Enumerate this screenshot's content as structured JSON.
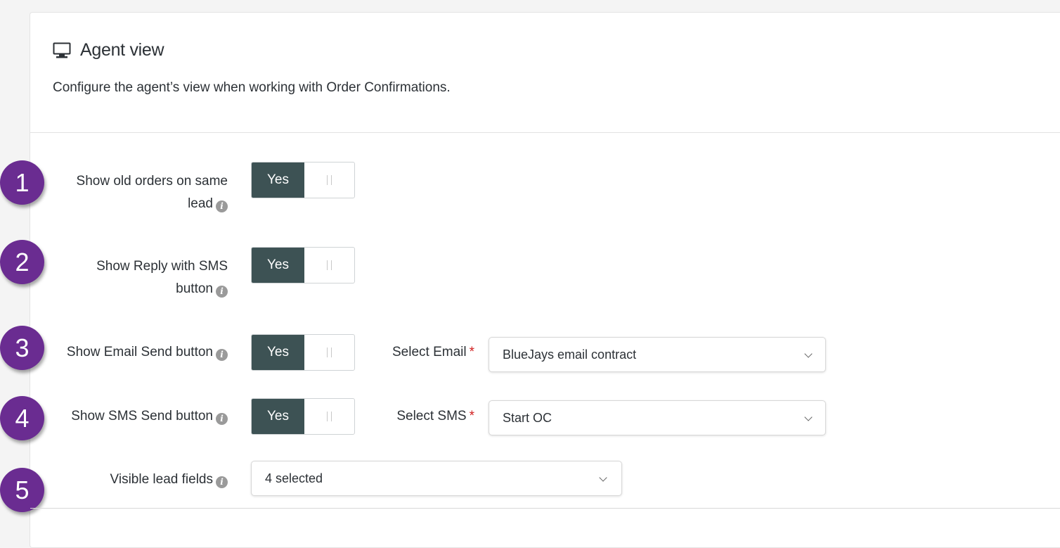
{
  "header": {
    "title": "Agent view",
    "subtitle": "Configure the agent’s view when working with Order Confirmations.",
    "icon": "monitor-icon"
  },
  "steps": [
    "1",
    "2",
    "3",
    "4",
    "5"
  ],
  "settings": {
    "old_orders": {
      "label_line1": "Show old orders on same",
      "label_line2": "lead",
      "toggle": "Yes"
    },
    "reply_sms": {
      "label_line1": "Show Reply with SMS",
      "label_line2": "button",
      "toggle": "Yes"
    },
    "email_send": {
      "label": "Show Email Send button",
      "toggle": "Yes",
      "select_label": "Select Email",
      "required_mark": "*",
      "select_value": "BlueJays email contract"
    },
    "sms_send": {
      "label": "Show SMS Send button",
      "toggle": "Yes",
      "select_label": "Select SMS",
      "required_mark": "*",
      "select_value": "Start OC"
    },
    "lead_fields": {
      "label": "Visible lead fields",
      "select_value": "4 selected"
    }
  },
  "info_glyph": "i",
  "colors": {
    "badge": "#6a2c91",
    "toggle_on": "#3d5254",
    "required": "#d11f1f"
  }
}
